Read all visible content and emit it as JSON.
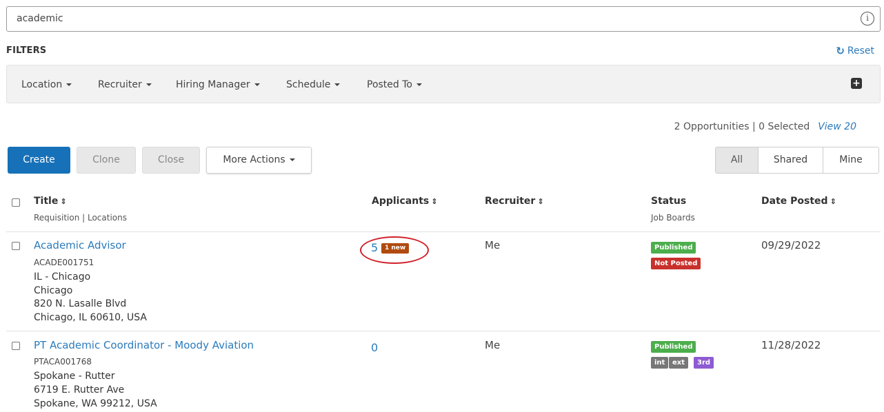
{
  "search": {
    "value": "academic"
  },
  "filters": {
    "title": "FILTERS",
    "reset_label": "Reset",
    "items": [
      "Location",
      "Recruiter",
      "Hiring Manager",
      "Schedule",
      "Posted To"
    ]
  },
  "summary": {
    "text": "2 Opportunities | 0 Selected",
    "view_label": "View 20"
  },
  "actions": {
    "create": "Create",
    "clone": "Clone",
    "close": "Close",
    "more": "More Actions"
  },
  "view_toggle": {
    "all": "All",
    "shared": "Shared",
    "mine": "Mine",
    "selected": "All"
  },
  "table": {
    "headers": {
      "title": "Title",
      "title_sub": "Requisition | Locations",
      "applicants": "Applicants",
      "recruiter": "Recruiter",
      "status": "Status",
      "status_sub": "Job Boards",
      "date_posted": "Date Posted"
    },
    "rows": [
      {
        "title": "Academic Advisor",
        "requisition": "ACADE001751",
        "locations": [
          "IL - Chicago",
          "Chicago",
          "820 N. Lasalle Blvd",
          "Chicago, IL 60610, USA"
        ],
        "applicants": "5",
        "new_badge": "1 new",
        "recruiter": "Me",
        "status": "Published",
        "job_boards": [
          "Not Posted"
        ],
        "date_posted": "09/29/2022"
      },
      {
        "title": "PT Academic Coordinator - Moody Aviation",
        "requisition": "PTACA001768",
        "locations": [
          "Spokane - Rutter",
          "6719 E. Rutter Ave",
          "Spokane, WA 99212, USA"
        ],
        "applicants": "0",
        "recruiter": "Me",
        "status": "Published",
        "job_boards": [
          "int",
          "ext",
          "3rd"
        ],
        "date_posted": "11/28/2022"
      }
    ]
  },
  "colors": {
    "accent": "#1771b8",
    "link": "#2a7bbd",
    "published": "#4cae4c",
    "not_posted": "#c9302c",
    "new_badge": "#b04a0e",
    "highlight": "#d0202a"
  }
}
